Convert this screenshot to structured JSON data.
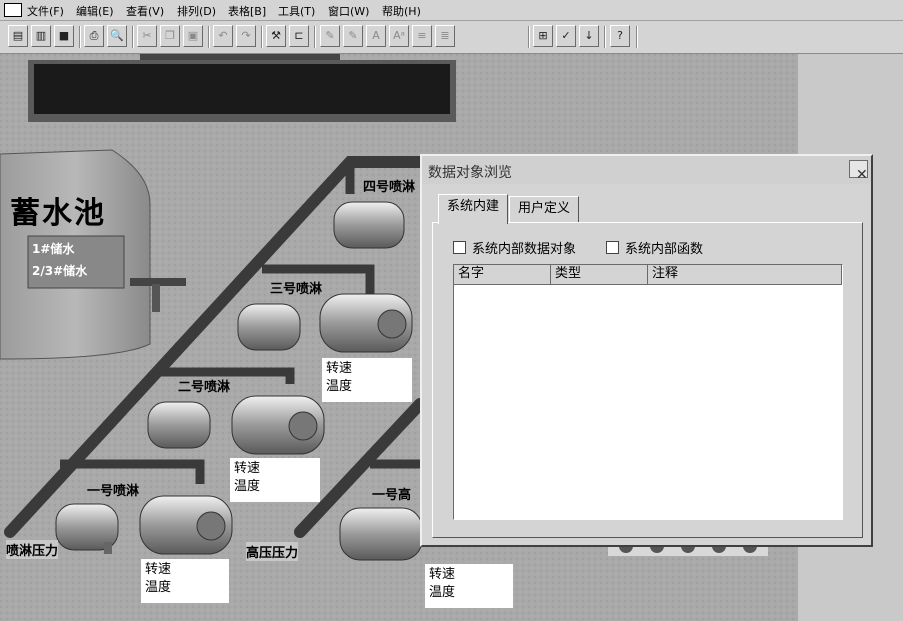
{
  "menu": [
    "文件(F)",
    "编辑(E)",
    "查看(V)",
    "排列(D)",
    "表格[B]",
    "工具(T)",
    "窗口(W)",
    "帮助(H)"
  ],
  "toolbar_icons": [
    "layers-icon",
    "panels-icon",
    "save-icon",
    "print-icon",
    "preview-icon",
    "cut-icon",
    "copy-icon",
    "paste-icon",
    "undo-icon",
    "redo-icon",
    "tools-icon",
    "frame-icon",
    "align-left-icon",
    "align-right-icon",
    "text-size-icon",
    "font-icon",
    "list-icon",
    "list2-icon",
    "properties-icon",
    "check-icon",
    "sort-icon",
    "help-icon"
  ],
  "scene": {
    "tank_title": "蓄水池",
    "tank_line1": "1#储水",
    "tank_line2": "2/3#储水",
    "spray4": "四号喷淋",
    "spray3": "三号喷淋",
    "spray2": "二号喷淋",
    "spray1": "一号喷淋",
    "high1": "一号高",
    "spray_pressure": "喷淋压力",
    "high_pressure": "高压压力",
    "speed": "转速",
    "temp": "温度"
  },
  "dialog": {
    "title": "数据对象浏览",
    "tab_system": "系统内建",
    "tab_user": "用户定义",
    "cb_objects": "系统内部数据对象",
    "cb_functions": "系统内部函数",
    "col_name": "名字",
    "col_type": "类型",
    "col_note": "注释",
    "close": "✕"
  }
}
